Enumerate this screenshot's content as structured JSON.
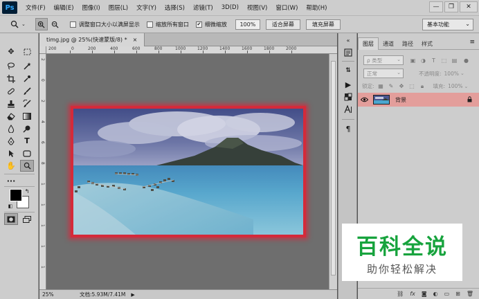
{
  "app": {
    "logo": "Ps"
  },
  "menu": [
    "文件(F)",
    "编辑(E)",
    "图像(I)",
    "图层(L)",
    "文字(Y)",
    "选择(S)",
    "滤镜(T)",
    "3D(D)",
    "视图(V)",
    "窗口(W)",
    "帮助(H)"
  ],
  "window_controls": {
    "minimize": "—",
    "restore": "❐",
    "close": "✕"
  },
  "options_bar": {
    "tool_icon": "zoom-icon",
    "resize_windows_label": "调整窗口大小以满屏显示",
    "resize_windows_checked": false,
    "zoom_all_label": "缩放所有窗口",
    "zoom_all_checked": false,
    "scrubby_zoom_label": "细微缩放",
    "scrubby_zoom_checked": true,
    "zoom_value": "100%",
    "fit_screen_label": "适合屏幕",
    "fill_screen_label": "填充屏幕",
    "workspace": "基本功能"
  },
  "document": {
    "tab_title": "timg.jpg @ 25%(快速蒙版/8) *",
    "tab_close": "×",
    "ruler_top_labels": [
      "200",
      "0",
      "200",
      "400",
      "600",
      "800",
      "1000",
      "1200",
      "1400",
      "1600",
      "1800",
      "2000"
    ],
    "ruler_left_labels": [
      "2",
      "0",
      "2",
      "4",
      "6",
      "8",
      "1",
      "1",
      "1",
      "1",
      "1"
    ]
  },
  "status": {
    "zoom": "25%",
    "doc_size": "文档:5.93M/7.41M",
    "arrow": "▶"
  },
  "layers_panel": {
    "tabs": [
      "图层",
      "通道",
      "路径",
      "样式"
    ],
    "active_tab": 0,
    "menu_icon": "≡",
    "kind_filter": "ρ 类型",
    "blend_mode": "正常",
    "opacity_label": "不透明度:",
    "opacity_value": "100%",
    "lock_label": "锁定:",
    "fill_label": "填充:",
    "fill_value": "100%",
    "layers": [
      {
        "name": "背景",
        "visible": true,
        "locked": true
      }
    ],
    "footer_icons": [
      "link-icon",
      "fx-icon",
      "mask-icon",
      "adjustment-icon",
      "group-icon",
      "new-layer-icon",
      "trash-icon"
    ]
  },
  "watermark": {
    "title": "百科全说",
    "subtitle": "助你轻松解决"
  },
  "colors": {
    "quick_mask_red": "#d42a3a",
    "watermark_green": "#17a33d",
    "layer_selected": "#e39e9b",
    "foreground": "#000000",
    "background": "#ffffff"
  }
}
